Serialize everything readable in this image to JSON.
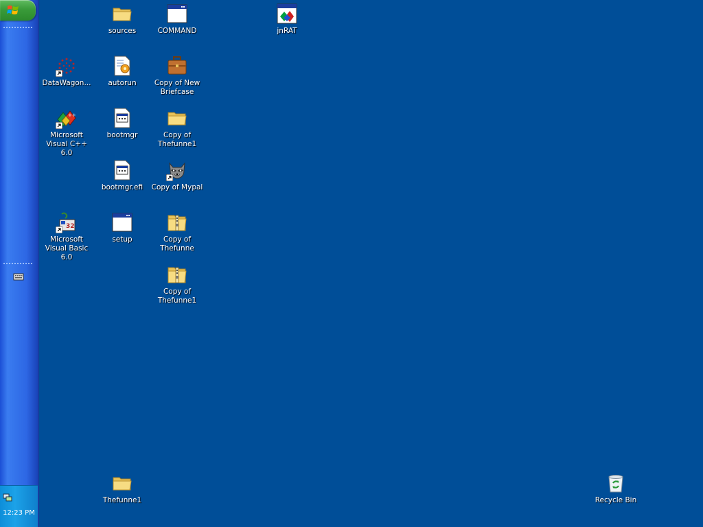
{
  "taskbar": {
    "start_button_label": "",
    "clock": "12:23 PM"
  },
  "desktop": {
    "icons": [
      {
        "label": "sources",
        "icon": "folder-icon"
      },
      {
        "label": "COMMAND",
        "icon": "window-app-icon"
      },
      {
        "label": "jnRAT",
        "icon": "jnrat-icon"
      },
      {
        "label": "DataWagon...",
        "icon": "datawagon-icon"
      },
      {
        "label": "autorun",
        "icon": "autorun-icon"
      },
      {
        "label": "Copy of New Briefcase",
        "icon": "briefcase-icon"
      },
      {
        "label": "Microsoft Visual C++ 6.0",
        "icon": "visual-cpp-icon"
      },
      {
        "label": "bootmgr",
        "icon": "system-file-icon"
      },
      {
        "label": "Copy of Thefunne1",
        "icon": "folder-icon"
      },
      {
        "label": "bootmgr.efi",
        "icon": "system-file-icon"
      },
      {
        "label": "Copy of Mypal",
        "icon": "mypal-raccoon-icon"
      },
      {
        "label": "Microsoft Visual Basic 6.0",
        "icon": "visual-basic-icon"
      },
      {
        "label": "setup",
        "icon": "window-app-icon"
      },
      {
        "label": "Copy of Thefunne",
        "icon": "zip-folder-icon"
      },
      {
        "label": "Copy of Thefunne1",
        "icon": "zip-folder-icon"
      },
      {
        "label": "Thefunne1",
        "icon": "folder-icon"
      },
      {
        "label": "Recycle Bin",
        "icon": "recycle-bin-icon"
      }
    ]
  },
  "colors": {
    "desktop_background": "#004e98",
    "taskbar": "#2d67e4",
    "start_button": "#3a9b3a",
    "tray": "#1ca2e8"
  }
}
